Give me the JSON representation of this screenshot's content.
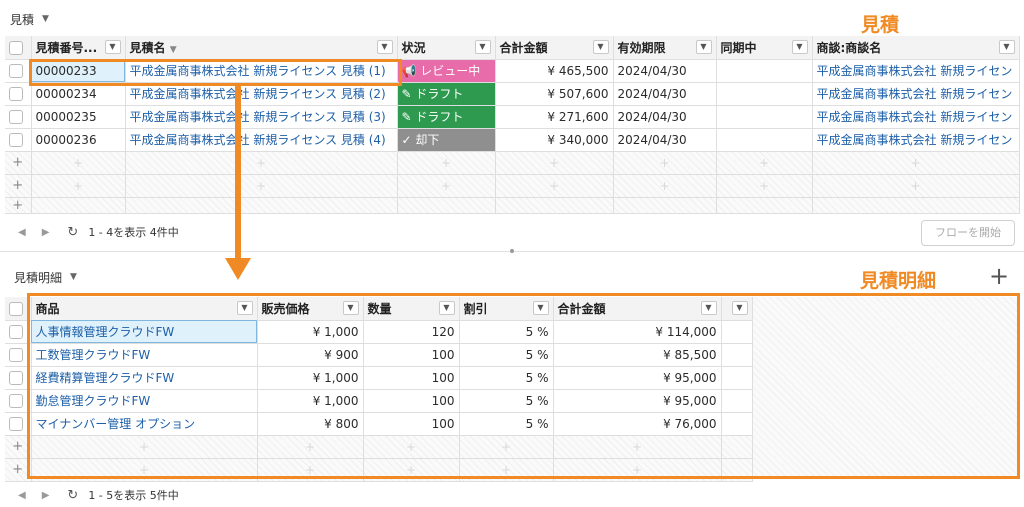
{
  "top": {
    "panel_title": "見積",
    "annotation_label": "見積",
    "columns": [
      "見積番号...",
      "見積名",
      "状況",
      "合計金額",
      "有効期限",
      "同期中",
      "商談:商談名"
    ],
    "rows": [
      {
        "number": "00000233",
        "name": "平成金属商事株式会社 新規ライセンス 見積 (1)",
        "status": "レビュー中",
        "status_icon": "megaphone-icon",
        "status_color": "#e86ca9",
        "total": "¥ 465,500",
        "expires": "2024/04/30",
        "opportunity": "平成金属商事株式会社 新規ライセン"
      },
      {
        "number": "00000234",
        "name": "平成金属商事株式会社 新規ライセンス 見積 (2)",
        "status": "ドラフト",
        "status_icon": "pencil-icon",
        "status_color": "#2e9a4f",
        "total": "¥ 507,600",
        "expires": "2024/04/30",
        "opportunity": "平成金属商事株式会社 新規ライセン"
      },
      {
        "number": "00000235",
        "name": "平成金属商事株式会社 新規ライセンス 見積 (3)",
        "status": "ドラフト",
        "status_icon": "pencil-icon",
        "status_color": "#2e9a4f",
        "total": "¥ 271,600",
        "expires": "2024/04/30",
        "opportunity": "平成金属商事株式会社 新規ライセン"
      },
      {
        "number": "00000236",
        "name": "平成金属商事株式会社 新規ライセンス 見積 (4)",
        "status": "却下",
        "status_icon": "checkmark-icon",
        "status_color": "#8f8f8f",
        "total": "¥ 340,000",
        "expires": "2024/04/30",
        "opportunity": "平成金属商事株式会社 新規ライセン"
      }
    ],
    "footer_text": "1 - 4を表示 4件中",
    "flow_button": "フローを開始"
  },
  "bottom": {
    "panel_title": "見積明細",
    "annotation_label": "見積明細",
    "add_symbol": "+",
    "columns": [
      "商品",
      "販売価格",
      "数量",
      "割引",
      "合計金額"
    ],
    "rows": [
      {
        "product": "人事情報管理クラウドFW",
        "price": "¥ 1,000",
        "qty": "120",
        "discount": "5 %",
        "total": "¥ 114,000"
      },
      {
        "product": "工数管理クラウドFW",
        "price": "¥ 900",
        "qty": "100",
        "discount": "5 %",
        "total": "¥ 85,500"
      },
      {
        "product": "経費精算管理クラウドFW",
        "price": "¥ 1,000",
        "qty": "100",
        "discount": "5 %",
        "total": "¥ 95,000"
      },
      {
        "product": "勤怠管理クラウドFW",
        "price": "¥ 1,000",
        "qty": "100",
        "discount": "5 %",
        "total": "¥ 95,000"
      },
      {
        "product": "マイナンバー管理 オプション",
        "price": "¥ 800",
        "qty": "100",
        "discount": "5 %",
        "total": "¥ 76,000"
      }
    ],
    "footer_text": "1 - 5を表示 5件中"
  },
  "colors": {
    "accent": "#f08a24",
    "link": "#1d5fa8",
    "review": "#e86ca9",
    "draft": "#2e9a4f",
    "rejected": "#8f8f8f"
  }
}
